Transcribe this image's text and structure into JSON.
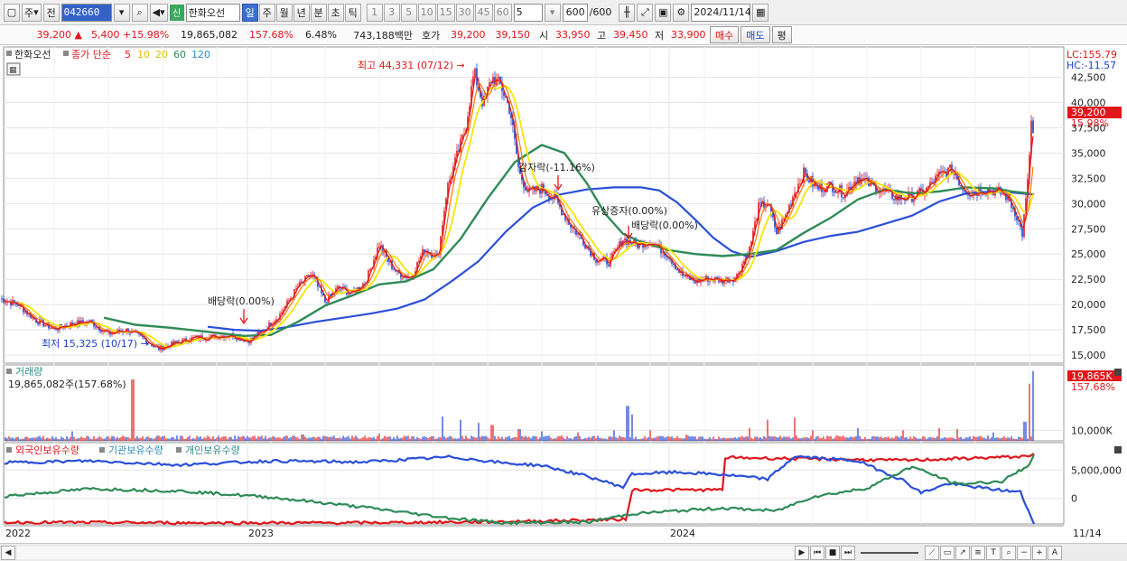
{
  "toolbar": {
    "period_label": "주",
    "prev_label": "전",
    "stock_code": "042660",
    "badge": "신",
    "stock_name": "한화오선",
    "intervals": [
      "일",
      "주",
      "월",
      "년",
      "분",
      "초",
      "틱"
    ],
    "active_interval": "일",
    "numbers": [
      "1",
      "3",
      "5",
      "10",
      "15",
      "30",
      "45",
      "60"
    ],
    "count_value": "5",
    "bars_value": "600",
    "bars_total": "/600",
    "date_value": "2024/11/14"
  },
  "info": {
    "price": "39,200",
    "arrow": "▲",
    "change": "5,400",
    "pct": "+15.98%",
    "volume": "19,865,082",
    "vol_pct": "157.68%",
    "turnover": "6.48%",
    "amount": "743,188백만",
    "bid_label": "호가",
    "ask": "39,200",
    "bid": "39,150",
    "open_label": "시",
    "open": "33,950",
    "high_label": "고",
    "high": "39,450",
    "low_label": "저",
    "low": "33,900",
    "buy_label": "매수",
    "sell_label": "매도",
    "avg_label": "평"
  },
  "chart_data": [
    {
      "type": "candlestick",
      "legend": {
        "name": "한화오선",
        "main": "종가 단순",
        "periods": [
          "5",
          "10",
          "20",
          "60",
          "120"
        ]
      },
      "y_ticks": [
        "15,000",
        "17,500",
        "20,000",
        "22,500",
        "25,000",
        "27,500",
        "30,000",
        "32,500",
        "35,000",
        "37,500",
        "40,000",
        "42,500"
      ],
      "ylim": [
        14200,
        45500
      ],
      "x_labels": [
        "2022",
        "2023",
        "2024"
      ],
      "x_end_label": "11/14",
      "lc_label": "LC:155.79",
      "hc_label": "HC:-11.57",
      "price_tag": "39,200",
      "price_pct_tag": "15.98%",
      "annotations": {
        "high": "최고 44,331 (07/12) →",
        "low": "최저 15,325 (10/17) →",
        "div1": "배당락(0.00%)",
        "div2": "감자락(-11.16%)",
        "div3": "유상증자(0.00%)",
        "div4": "배당락(0.00%)"
      },
      "close_series": [
        [
          0,
          20600
        ],
        [
          20,
          20000
        ],
        [
          40,
          18400
        ],
        [
          60,
          17600
        ],
        [
          80,
          18100
        ],
        [
          100,
          18300
        ],
        [
          120,
          17100
        ],
        [
          140,
          17500
        ],
        [
          160,
          16600
        ],
        [
          175,
          15600
        ],
        [
          195,
          16200
        ],
        [
          215,
          16700
        ],
        [
          235,
          16800
        ],
        [
          255,
          17000
        ],
        [
          275,
          16400
        ],
        [
          290,
          17300
        ],
        [
          310,
          19000
        ],
        [
          330,
          21800
        ],
        [
          345,
          23000
        ],
        [
          360,
          20300
        ],
        [
          375,
          21700
        ],
        [
          390,
          21100
        ],
        [
          405,
          22300
        ],
        [
          420,
          26000
        ],
        [
          430,
          24300
        ],
        [
          440,
          23100
        ],
        [
          455,
          22700
        ],
        [
          470,
          25500
        ],
        [
          485,
          24700
        ],
        [
          495,
          31500
        ],
        [
          505,
          34400
        ],
        [
          515,
          37300
        ],
        [
          525,
          43000
        ],
        [
          535,
          39800
        ],
        [
          545,
          42500
        ],
        [
          555,
          41600
        ],
        [
          565,
          39200
        ],
        [
          575,
          33000
        ],
        [
          585,
          31100
        ],
        [
          600,
          31500
        ],
        [
          615,
          30400
        ],
        [
          630,
          28100
        ],
        [
          645,
          26400
        ],
        [
          660,
          24500
        ],
        [
          675,
          24200
        ],
        [
          690,
          26500
        ],
        [
          705,
          25900
        ],
        [
          720,
          26300
        ],
        [
          740,
          24900
        ],
        [
          755,
          22900
        ],
        [
          770,
          22300
        ],
        [
          785,
          22600
        ],
        [
          800,
          22400
        ],
        [
          815,
          22700
        ],
        [
          830,
          25500
        ],
        [
          840,
          29600
        ],
        [
          850,
          30100
        ],
        [
          860,
          27100
        ],
        [
          870,
          28800
        ],
        [
          880,
          31200
        ],
        [
          890,
          33000
        ],
        [
          905,
          31500
        ],
        [
          920,
          31800
        ],
        [
          935,
          31000
        ],
        [
          950,
          32600
        ],
        [
          965,
          31800
        ],
        [
          980,
          31100
        ],
        [
          995,
          30500
        ],
        [
          1010,
          30700
        ],
        [
          1025,
          31300
        ],
        [
          1040,
          32800
        ],
        [
          1055,
          33400
        ],
        [
          1065,
          31700
        ],
        [
          1075,
          31000
        ],
        [
          1090,
          31400
        ],
        [
          1105,
          31200
        ],
        [
          1115,
          30700
        ],
        [
          1125,
          29000
        ],
        [
          1132,
          27000
        ],
        [
          1138,
          32000
        ],
        [
          1142,
          38000
        ],
        [
          1145,
          36300
        ]
      ],
      "ma60_series": [
        [
          115,
          18700
        ],
        [
          150,
          18000
        ],
        [
          190,
          17700
        ],
        [
          230,
          17300
        ],
        [
          270,
          16900
        ],
        [
          300,
          17000
        ],
        [
          330,
          18300
        ],
        [
          360,
          19900
        ],
        [
          390,
          20900
        ],
        [
          420,
          22000
        ],
        [
          450,
          22300
        ],
        [
          480,
          23500
        ],
        [
          510,
          26500
        ],
        [
          540,
          30500
        ],
        [
          570,
          34100
        ],
        [
          600,
          35800
        ],
        [
          625,
          35000
        ],
        [
          650,
          32000
        ],
        [
          670,
          29000
        ],
        [
          690,
          27000
        ],
        [
          710,
          26200
        ],
        [
          740,
          25400
        ],
        [
          770,
          25000
        ],
        [
          800,
          24800
        ],
        [
          830,
          25000
        ],
        [
          860,
          25400
        ],
        [
          890,
          27100
        ],
        [
          920,
          28600
        ],
        [
          950,
          30400
        ],
        [
          980,
          31400
        ],
        [
          1010,
          31000
        ],
        [
          1040,
          31200
        ],
        [
          1070,
          31600
        ],
        [
          1100,
          31500
        ],
        [
          1120,
          31200
        ],
        [
          1140,
          31000
        ]
      ],
      "ma120_series": [
        [
          230,
          17800
        ],
        [
          260,
          17500
        ],
        [
          290,
          17400
        ],
        [
          320,
          17800
        ],
        [
          350,
          18300
        ],
        [
          380,
          18700
        ],
        [
          410,
          19100
        ],
        [
          440,
          19600
        ],
        [
          470,
          20500
        ],
        [
          500,
          22300
        ],
        [
          530,
          24300
        ],
        [
          560,
          27200
        ],
        [
          590,
          29600
        ],
        [
          620,
          30900
        ],
        [
          650,
          31400
        ],
        [
          680,
          31600
        ],
        [
          710,
          31600
        ],
        [
          730,
          31300
        ],
        [
          750,
          30100
        ],
        [
          770,
          28400
        ],
        [
          790,
          26600
        ],
        [
          810,
          25300
        ],
        [
          830,
          24700
        ],
        [
          860,
          25300
        ],
        [
          890,
          26200
        ],
        [
          920,
          26800
        ],
        [
          950,
          27200
        ],
        [
          980,
          28000
        ],
        [
          1010,
          28800
        ],
        [
          1040,
          30200
        ],
        [
          1070,
          31000
        ],
        [
          1100,
          31200
        ],
        [
          1120,
          31100
        ],
        [
          1145,
          30900
        ]
      ]
    },
    {
      "type": "bar",
      "label": "거래량",
      "value_text": "19,865,082주(157.68%)",
      "y_tick": "10,000K",
      "tag_value": "19,865K",
      "tag_pct": "157.68%",
      "ylim": [
        0,
        70000
      ],
      "spikes": [
        [
          80,
          9000
        ],
        [
          147,
          58000
        ],
        [
          260,
          5000
        ],
        [
          300,
          3000
        ],
        [
          335,
          6000
        ],
        [
          420,
          7000
        ],
        [
          490,
          23000
        ],
        [
          510,
          20000
        ],
        [
          530,
          17000
        ],
        [
          545,
          15000
        ],
        [
          575,
          11000
        ],
        [
          600,
          9000
        ],
        [
          640,
          8000
        ],
        [
          680,
          10000
        ],
        [
          695,
          33000
        ],
        [
          700,
          25000
        ],
        [
          720,
          10000
        ],
        [
          760,
          6000
        ],
        [
          830,
          12000
        ],
        [
          850,
          20000
        ],
        [
          880,
          22000
        ],
        [
          900,
          10000
        ],
        [
          950,
          12000
        ],
        [
          1000,
          10000
        ],
        [
          1040,
          12000
        ],
        [
          1060,
          11000
        ],
        [
          1100,
          8000
        ],
        [
          1135,
          18000
        ],
        [
          1140,
          54000
        ],
        [
          1145,
          66000
        ]
      ]
    },
    {
      "type": "line",
      "legend": [
        "외국인보유수량",
        "기관보유수량",
        "개인보유수량"
      ],
      "y_ticks": [
        "5,000,000",
        "0"
      ],
      "ylim": [
        -4500000,
        9500000
      ],
      "series": [
        {
          "name": "외국인보유수량",
          "color": "#e0161b",
          "points": [
            [
              5,
              -4200000
            ],
            [
              200,
              -4300000
            ],
            [
              400,
              -4300000
            ],
            [
              550,
              -4100000
            ],
            [
              693,
              -3700000
            ],
            [
              700,
              1500000
            ],
            [
              800,
              1500000
            ],
            [
              803,
              7200000
            ],
            [
              1000,
              6700000
            ],
            [
              1140,
              7400000
            ],
            [
              1145,
              7900000
            ]
          ]
        },
        {
          "name": "기관보유수량",
          "color": "#2a4fd8",
          "points": [
            [
              5,
              6300000
            ],
            [
              100,
              6600000
            ],
            [
              200,
              5900000
            ],
            [
              300,
              6600000
            ],
            [
              400,
              6400000
            ],
            [
              500,
              7300000
            ],
            [
              560,
              6200000
            ],
            [
              600,
              5800000
            ],
            [
              650,
              3900000
            ],
            [
              690,
              2000000
            ],
            [
              700,
              4300000
            ],
            [
              750,
              4600000
            ],
            [
              800,
              4200000
            ],
            [
              850,
              3400000
            ],
            [
              880,
              7400000
            ],
            [
              950,
              6600000
            ],
            [
              1000,
              3200000
            ],
            [
              1020,
              1000000
            ],
            [
              1050,
              2600000
            ],
            [
              1100,
              1600000
            ],
            [
              1130,
              1100000
            ],
            [
              1145,
              -4500000
            ]
          ]
        },
        {
          "name": "개인보유수량",
          "color": "#2e8b57",
          "points": [
            [
              5,
              400000
            ],
            [
              100,
              1700000
            ],
            [
              200,
              1300000
            ],
            [
              300,
              200000
            ],
            [
              400,
              -1500000
            ],
            [
              500,
              -3500000
            ],
            [
              560,
              -4300000
            ],
            [
              650,
              -4200000
            ],
            [
              700,
              -2700000
            ],
            [
              800,
              -1700000
            ],
            [
              860,
              -2200000
            ],
            [
              900,
              300000
            ],
            [
              960,
              1800000
            ],
            [
              1010,
              5600000
            ],
            [
              1060,
              2500000
            ],
            [
              1110,
              3000000
            ],
            [
              1140,
              6000000
            ],
            [
              1145,
              7700000
            ]
          ]
        }
      ]
    }
  ],
  "colors": {
    "up": "#e0161b",
    "down": "#1a3fcc",
    "ma5": "#ff2a2a",
    "ma10": "#f5e600",
    "ma20": "#2e8b57",
    "ma60": "#2a4fd8"
  }
}
